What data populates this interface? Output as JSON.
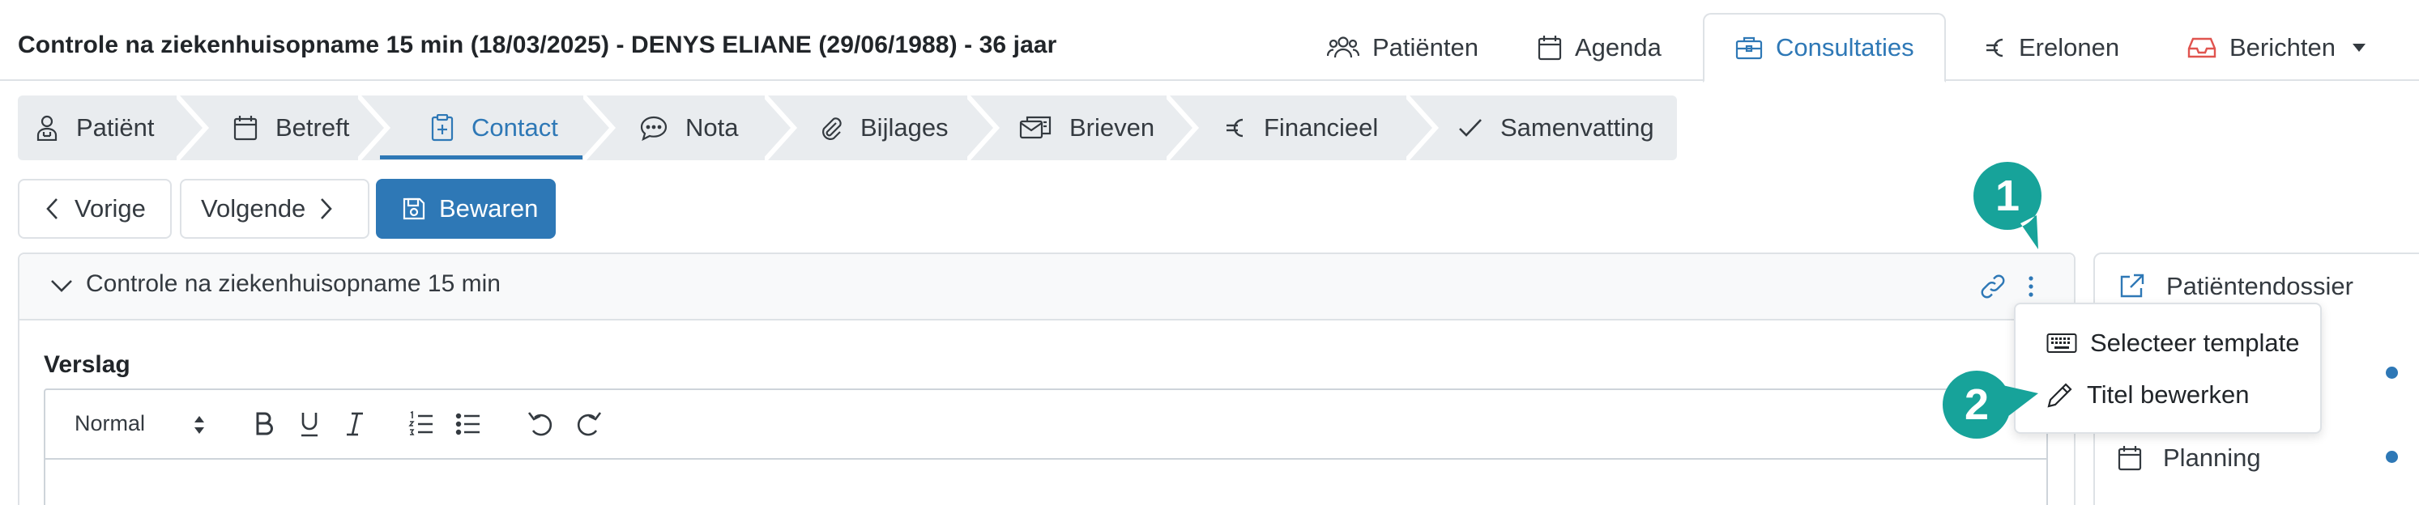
{
  "header": {
    "title": "Controle na ziekenhuisopname 15 min (18/03/2025) - DENYS ELIANE (29/06/1988) - 36 jaar",
    "nav": [
      {
        "label": "Patiënten",
        "icon": "users-icon"
      },
      {
        "label": "Agenda",
        "icon": "calendar-icon"
      },
      {
        "label": "Consultaties",
        "icon": "briefcase-icon",
        "active": true
      },
      {
        "label": "Erelonen",
        "icon": "euro-icon"
      },
      {
        "label": "Berichten",
        "icon": "inbox-icon"
      }
    ]
  },
  "steps": [
    {
      "label": "Patiënt",
      "icon": "patient-icon"
    },
    {
      "label": "Betreft",
      "icon": "calendar-icon"
    },
    {
      "label": "Contact",
      "icon": "clipboard-plus-icon",
      "active": true
    },
    {
      "label": "Nota",
      "icon": "chat-icon"
    },
    {
      "label": "Bijlages",
      "icon": "paperclip-icon"
    },
    {
      "label": "Brieven",
      "icon": "letters-icon"
    },
    {
      "label": "Financieel",
      "icon": "euro-icon"
    },
    {
      "label": "Samenvatting",
      "icon": "check-icon"
    }
  ],
  "actions": {
    "previous": "Vorige",
    "next": "Volgende",
    "save": "Bewaren"
  },
  "panel": {
    "title": "Controle na ziekenhuisopname 15 min",
    "section_label": "Verslag",
    "editor": {
      "format_select": "Normal"
    }
  },
  "menu": {
    "items": [
      {
        "label": "Selecteer template",
        "icon": "keyboard-icon"
      },
      {
        "label": "Titel bewerken",
        "icon": "pencil-icon"
      }
    ]
  },
  "side": {
    "items": [
      {
        "label": "Patiëntendossier",
        "icon": "external-link-icon"
      },
      {
        "label": "Planning",
        "icon": "calendar-icon"
      }
    ]
  },
  "annotations": {
    "badge1": "1",
    "badge2": "2"
  },
  "colors": {
    "accent": "#2e78b6",
    "badge": "#17a39a",
    "inbox_icon": "#e0544f",
    "step_bar": "#e9ecef"
  }
}
